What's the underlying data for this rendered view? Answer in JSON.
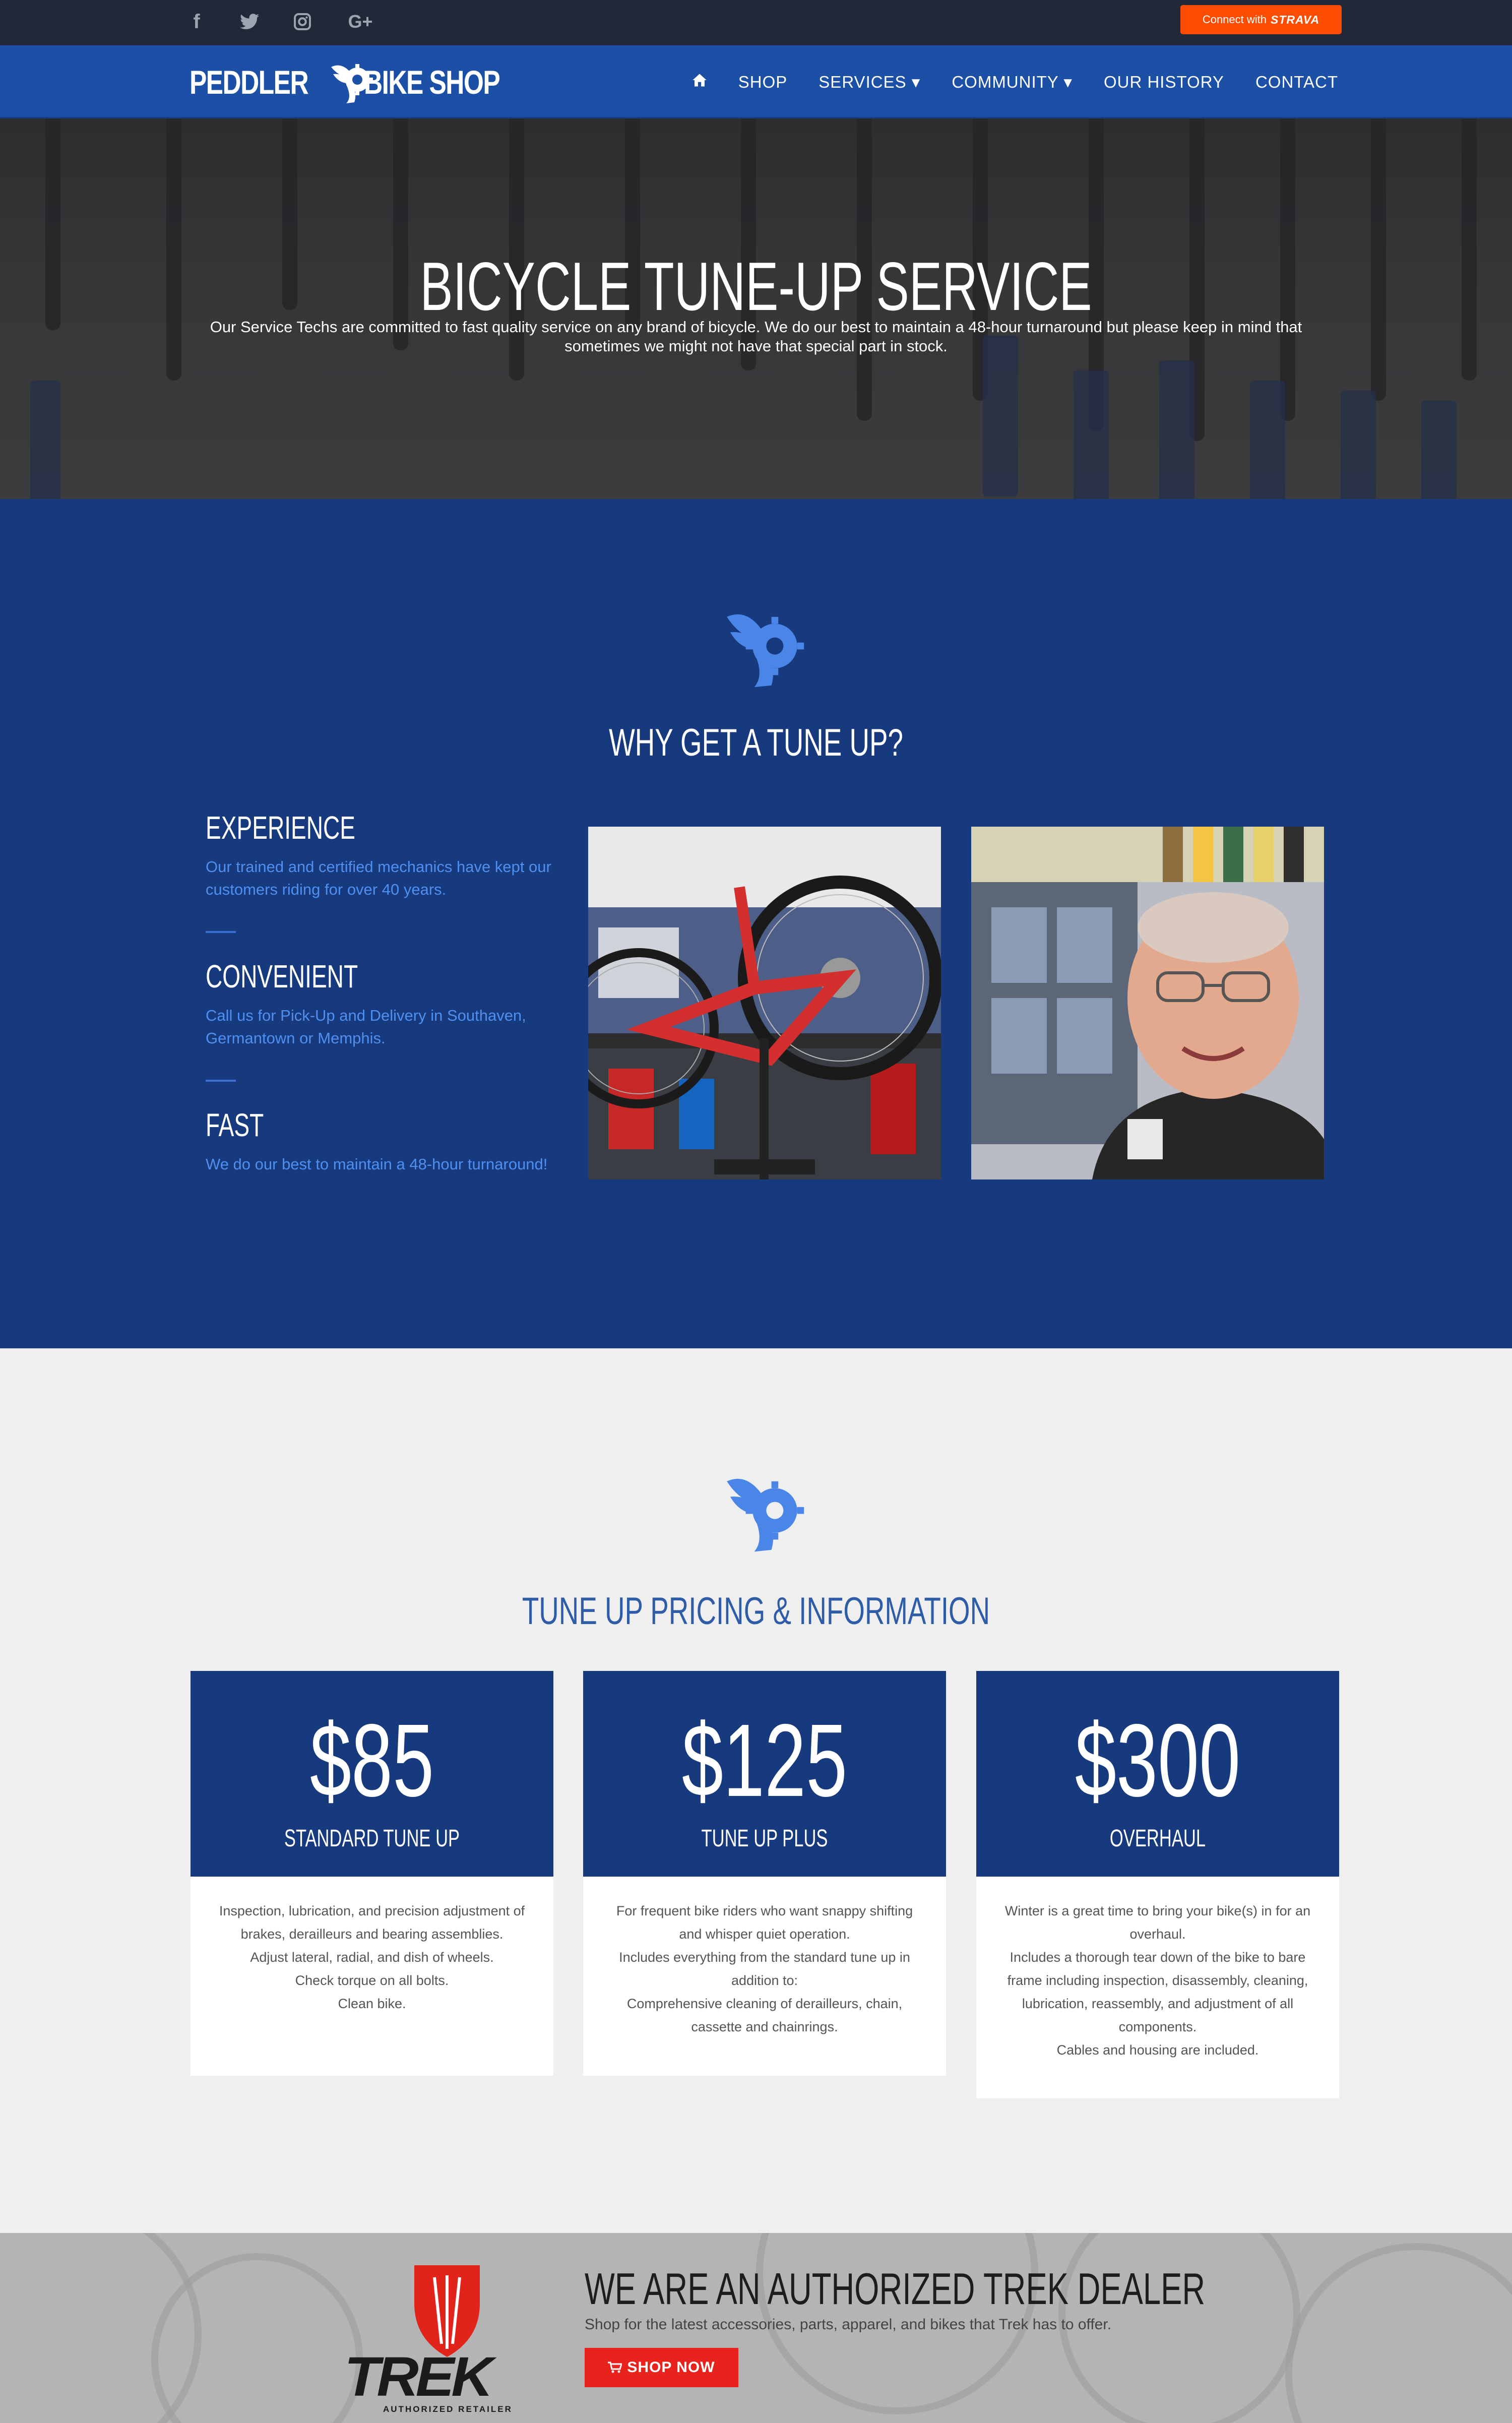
{
  "topbar": {
    "social": [
      {
        "icon": "facebook-icon",
        "glyph": "f"
      },
      {
        "icon": "twitter-icon",
        "glyph": "🐦"
      },
      {
        "icon": "instagram-icon",
        "glyph": "◎"
      },
      {
        "icon": "google-plus-icon",
        "glyph": "G+"
      }
    ],
    "strava_prefix": "Connect with",
    "strava_brand": "STRAVA"
  },
  "nav": {
    "logo_left": "PEDDLER",
    "logo_right": "BIKE SHOP",
    "home_icon": "⌂",
    "items": [
      "SHOP",
      "SERVICES ▾",
      "COMMUNITY ▾",
      "OUR HISTORY",
      "CONTACT"
    ]
  },
  "hero": {
    "title": "BICYCLE TUNE-UP SERVICE",
    "subtitle": "Our Service Techs are committed to fast quality service on any brand of bicycle. We do our best to maintain a 48-hour turnaround but please keep in mind that sometimes we might not have that special part in stock."
  },
  "why": {
    "title": "WHY GET A TUNE UP?",
    "features": [
      {
        "title": "EXPERIENCE",
        "text": "Our trained and certified mechanics have kept our customers riding for over 40 years."
      },
      {
        "title": "CONVENIENT",
        "text": "Call us for Pick-Up and Delivery in Southaven, Germantown or Memphis."
      },
      {
        "title": "FAST",
        "text": "We do our best to maintain a 48-hour turnaround!"
      }
    ]
  },
  "pricing": {
    "title": "TUNE UP PRICING & INFORMATION",
    "plans": [
      {
        "price": "$85",
        "name": "STANDARD TUNE UP",
        "lines": [
          "Inspection, lubrication, and precision adjustment of brakes, derailleurs and bearing assemblies.",
          "Adjust lateral, radial, and dish of wheels.",
          "Check torque on all bolts.",
          "Clean bike."
        ]
      },
      {
        "price": "$125",
        "name": "TUNE UP PLUS",
        "lines": [
          "For frequent bike riders who want snappy shifting and whisper quiet operation.",
          "Includes everything from the standard tune up in addition to:",
          "Comprehensive cleaning of derailleurs, chain, cassette and chainrings."
        ]
      },
      {
        "price": "$300",
        "name": "OVERHAUL",
        "lines": [
          "Winter is a great time to bring your bike(s) in for an overhaul.",
          "Includes a thorough tear down of the bike to bare frame including inspection, disassembly, cleaning, lubrication, reassembly, and adjustment of all components.",
          "Cables and housing are included."
        ]
      }
    ]
  },
  "trek": {
    "brand": "TREK",
    "authorized": "AUTHORIZED RETAILER",
    "title": "WE ARE AN AUTHORIZED TREK DEALER",
    "subtitle": "Shop for the latest accessories, parts, apparel, and bikes that Trek has to offer.",
    "button": "SHOP NOW"
  },
  "colors": {
    "topbar": "#222837",
    "nav": "#1c4fa6",
    "section_blue": "#173a7e",
    "accent_link": "#4f8ff0",
    "strava": "#fc4c02",
    "shop_button": "#e8231d"
  }
}
